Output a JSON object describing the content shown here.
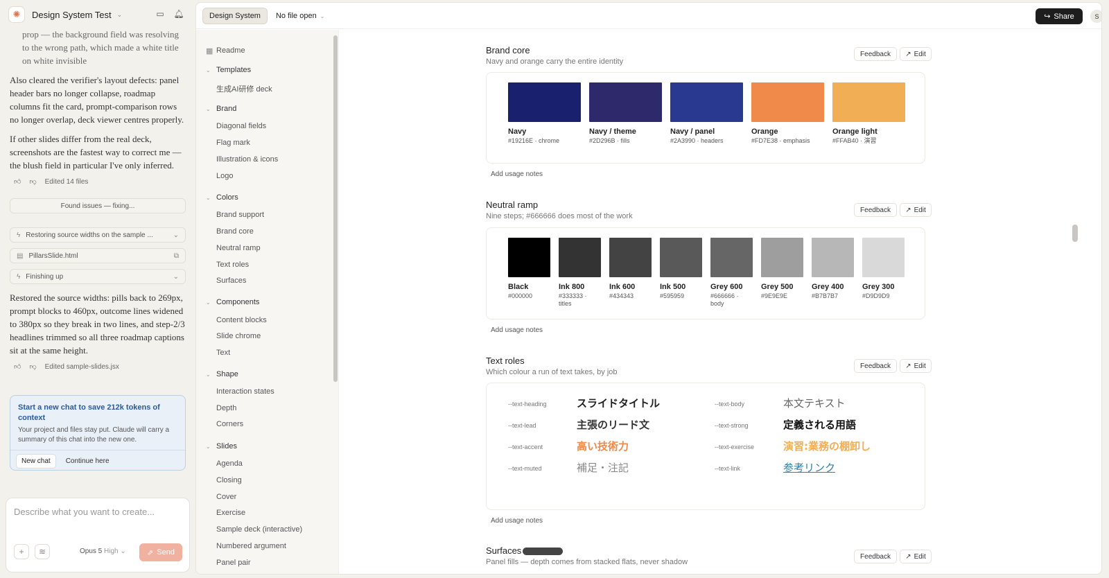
{
  "project": {
    "title": "Design System Test"
  },
  "chat": {
    "faded": "prop — the background field was resolving to the wrong path, which made a white title on white invisible",
    "p1": "Also cleared the verifier's layout defects: panel header bars no longer collapse, roadmap columns fit the card, prompt-comparison rows no longer overlap, deck viewer centres properly.",
    "p2": "If other slides differ from the real deck, screenshots are the fastest way to correct me — the blush field in particular I've only inferred.",
    "edited1": "Edited 14 files",
    "found": "Found issues — fixing...",
    "restoring": "Restoring source widths on the sample ...",
    "file": "PillarsSlide.html",
    "finishing": "Finishing up",
    "p3": "Restored the source widths: pills back to 269px, prompt blocks to 460px, outcome lines widened to 380px so they break in two lines, and step-2/3 headlines trimmed so all three roadmap captions sit at the same height.",
    "edited2": "Edited sample-slides.jsx"
  },
  "notice": {
    "title": "Start a new chat to save 212k tokens of context",
    "desc": "Your project and files stay put. Claude will carry a summary of this chat into the new one.",
    "new_chat": "New chat",
    "continue": "Continue here"
  },
  "composer": {
    "placeholder": "Describe what you want to create...",
    "model": "Opus 5",
    "effort": "High",
    "send": "Send"
  },
  "topbar": {
    "tab": "Design System",
    "file": "No file open",
    "share": "Share",
    "avatar": "S"
  },
  "tree": {
    "readme": "Readme",
    "templates": "Templates",
    "deck": "生成AI研修 deck",
    "brand": "Brand",
    "b1": "Diagonal fields",
    "b2": "Flag mark",
    "b3": "Illustration & icons",
    "b4": "Logo",
    "colors": "Colors",
    "c1": "Brand support",
    "c2": "Brand core",
    "c3": "Neutral ramp",
    "c4": "Text roles",
    "c5": "Surfaces",
    "components": "Components",
    "k1": "Content blocks",
    "k2": "Slide chrome",
    "k3": "Text",
    "shape": "Shape",
    "s1": "Interaction states",
    "s2": "Depth",
    "s3": "Corners",
    "slides": "Slides",
    "l1": "Agenda",
    "l2": "Closing",
    "l3": "Cover",
    "l4": "Exercise",
    "l5": "Sample deck (interactive)",
    "l6": "Numbered argument",
    "l7": "Panel pair"
  },
  "actions": {
    "feedback": "Feedback",
    "edit": "Edit",
    "usage": "Add usage notes"
  },
  "brand_core": {
    "title": "Brand core",
    "subtitle": "Navy and orange carry the entire identity",
    "swatches": [
      {
        "name": "Navy",
        "hex": "#19216E · chrome",
        "color": "#19216E"
      },
      {
        "name": "Navy / theme",
        "hex": "#2D296B · fills",
        "color": "#2D296B"
      },
      {
        "name": "Navy / panel",
        "hex": "#2A3990 · headers",
        "color": "#2A3990"
      },
      {
        "name": "Orange",
        "hex": "#FD7E38 · emphasis",
        "color": "#EF8A4A"
      },
      {
        "name": "Orange light",
        "hex": "#FFAB40 · 演習",
        "color": "#F2AE55"
      }
    ]
  },
  "neutral": {
    "title": "Neutral ramp",
    "subtitle": "Nine steps; #666666 does most of the work",
    "swatches": [
      {
        "name": "Black",
        "hex": "#000000",
        "color": "#000000"
      },
      {
        "name": "Ink 800",
        "hex": "#333333 · titles",
        "color": "#333333"
      },
      {
        "name": "Ink 600",
        "hex": "#434343",
        "color": "#434343"
      },
      {
        "name": "Ink 500",
        "hex": "#595959",
        "color": "#595959"
      },
      {
        "name": "Grey 600",
        "hex": "#666666 · body",
        "color": "#666666"
      },
      {
        "name": "Grey 500",
        "hex": "#9E9E9E",
        "color": "#9E9E9E"
      },
      {
        "name": "Grey 400",
        "hex": "#B7B7B7",
        "color": "#B7B7B7"
      },
      {
        "name": "Grey 300",
        "hex": "#D9D9D9",
        "color": "#D9D9D9"
      }
    ]
  },
  "text_roles": {
    "title": "Text roles",
    "subtitle": "Which colour a run of text takes, by job",
    "roles": [
      {
        "token": "--text-heading",
        "sample": "スライドタイトル",
        "color": "#222222",
        "bold": true
      },
      {
        "token": "--text-body",
        "sample": "本文テキスト",
        "color": "#666666",
        "bold": false
      },
      {
        "token": "--text-lead",
        "sample": "主張のリード文",
        "color": "#333333",
        "bold": true
      },
      {
        "token": "--text-strong",
        "sample": "定義される用語",
        "color": "#111111",
        "bold": true
      },
      {
        "token": "--text-accent",
        "sample": "高い技術力",
        "color": "#EF8A4A",
        "bold": true
      },
      {
        "token": "--text-exercise",
        "sample": "演習:業務の棚卸し",
        "color": "#F2AE55",
        "bold": true
      },
      {
        "token": "--text-muted",
        "sample": "補足・注記",
        "color": "#888888",
        "bold": false
      },
      {
        "token": "--text-link",
        "sample": "参考リンク",
        "color": "#2E7FA8",
        "bold": false
      }
    ]
  },
  "surfaces": {
    "title": "Surfaces",
    "subtitle": "Panel fills — depth comes from stacked flats, never shadow"
  }
}
